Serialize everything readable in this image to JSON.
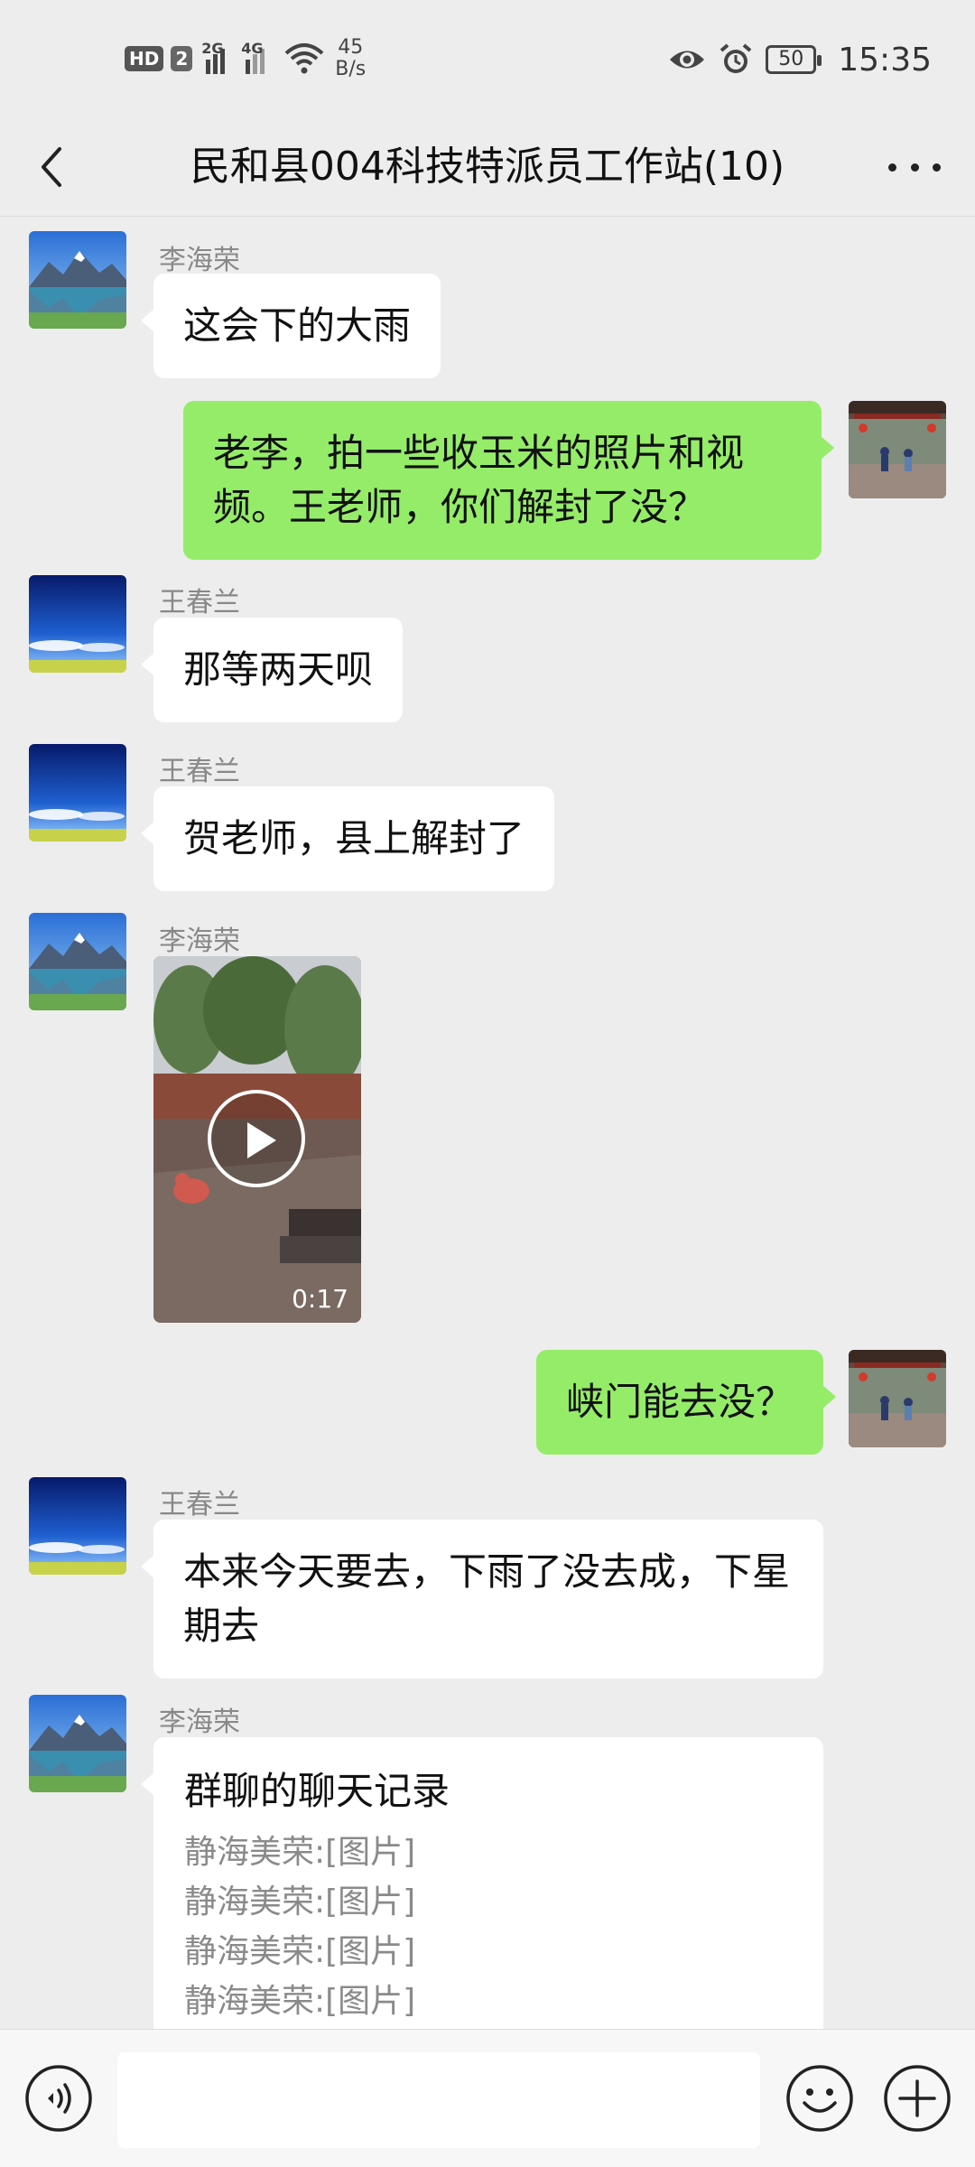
{
  "status_bar": {
    "hd_label": "HD",
    "sim_label": "2",
    "net1": "2G",
    "net2": "4G",
    "speed_value": "45",
    "speed_unit": "B/s",
    "battery": "50",
    "time": "15:35"
  },
  "header": {
    "title": "民和县004科技特派员工作站(10)"
  },
  "messages": [
    {
      "sender": "李海荣",
      "text": "这会下的大雨"
    },
    {
      "sender": "",
      "text": "老李，拍一些收玉米的照片和视频。王老师，你们解封了没？"
    },
    {
      "sender": "王春兰",
      "text": "那等两天呗"
    },
    {
      "sender": "王春兰",
      "text": "贺老师，县上解封了"
    },
    {
      "sender": "李海荣",
      "video_duration": "0:17"
    },
    {
      "sender": "",
      "text": "峡门能去没？"
    },
    {
      "sender": "王春兰",
      "text": "本来今天要去，下雨了没去成，下星期去"
    },
    {
      "sender": "李海荣",
      "record_title": "群聊的聊天记录",
      "record_lines": [
        "静海美荣:[图片]",
        "静海美荣:[图片]",
        "静海美荣:[图片]",
        "静海美荣:[图片]"
      ]
    }
  ],
  "input_bar": {
    "placeholder": ""
  },
  "colors": {
    "background": "#ededed",
    "outgoing_bubble": "#95ec69",
    "incoming_bubble": "#ffffff"
  }
}
